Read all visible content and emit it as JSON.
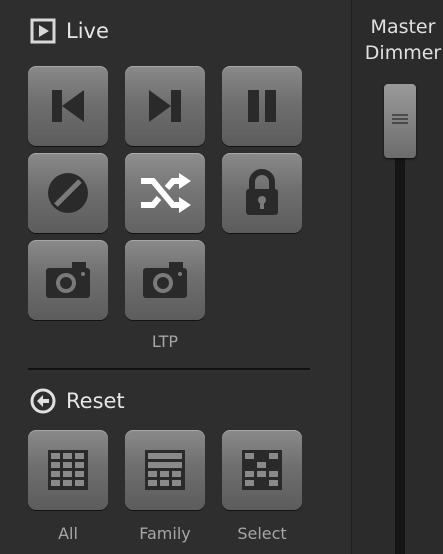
{
  "live_section": {
    "title": "Live",
    "buttons": [
      {
        "icon": "skip-previous-icon"
      },
      {
        "icon": "skip-next-icon"
      },
      {
        "icon": "pause-icon"
      },
      {
        "icon": "blackout-icon"
      },
      {
        "icon": "shuffle-icon"
      },
      {
        "icon": "lock-icon"
      },
      {
        "icon": "camera-icon"
      },
      {
        "icon": "camera-icon"
      }
    ],
    "ltp_label": "LTP"
  },
  "reset_section": {
    "title": "Reset",
    "buttons": [
      {
        "label": "All",
        "icon": "grid-all-icon"
      },
      {
        "label": "Family",
        "icon": "grid-family-icon"
      },
      {
        "label": "Select",
        "icon": "grid-select-icon"
      }
    ]
  },
  "master": {
    "label_line1": "Master",
    "label_line2": "Dimmer",
    "level": 1.0
  }
}
